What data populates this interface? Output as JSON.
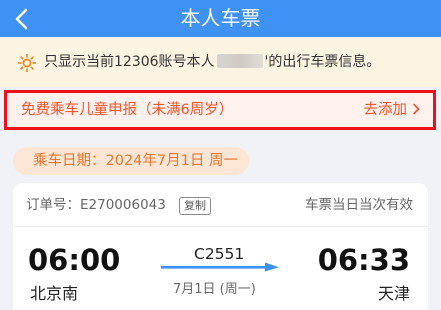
{
  "header": {
    "title": "本人车票",
    "back_icon": "chevron-left-icon"
  },
  "notice": {
    "icon": "sun-icon",
    "text_before": "只显示当前12306账号本人",
    "text_after": "'的出行车票信息。"
  },
  "child_declaration": {
    "label": "免费乘车儿童申报（未满6周岁）",
    "action": "去添加",
    "action_icon": "chevron-right-icon",
    "color": "#f0552b",
    "border_color": "#e8131f"
  },
  "travel_date": {
    "text": "乘车日期：2024年7月1日 周一"
  },
  "ticket": {
    "order_label": "订单号：E270006043",
    "copy_label": "复制",
    "validity": "车票当日当次有效",
    "departure_time": "06:00",
    "arrival_time": "06:33",
    "departure_station": "北京南",
    "arrival_station": "天津",
    "train_number": "C2551",
    "train_date": "7月1日 (周一)"
  },
  "colors": {
    "header": "#3e92f4",
    "accent_orange": "#e8772c",
    "arrow": "#3e92f4"
  }
}
